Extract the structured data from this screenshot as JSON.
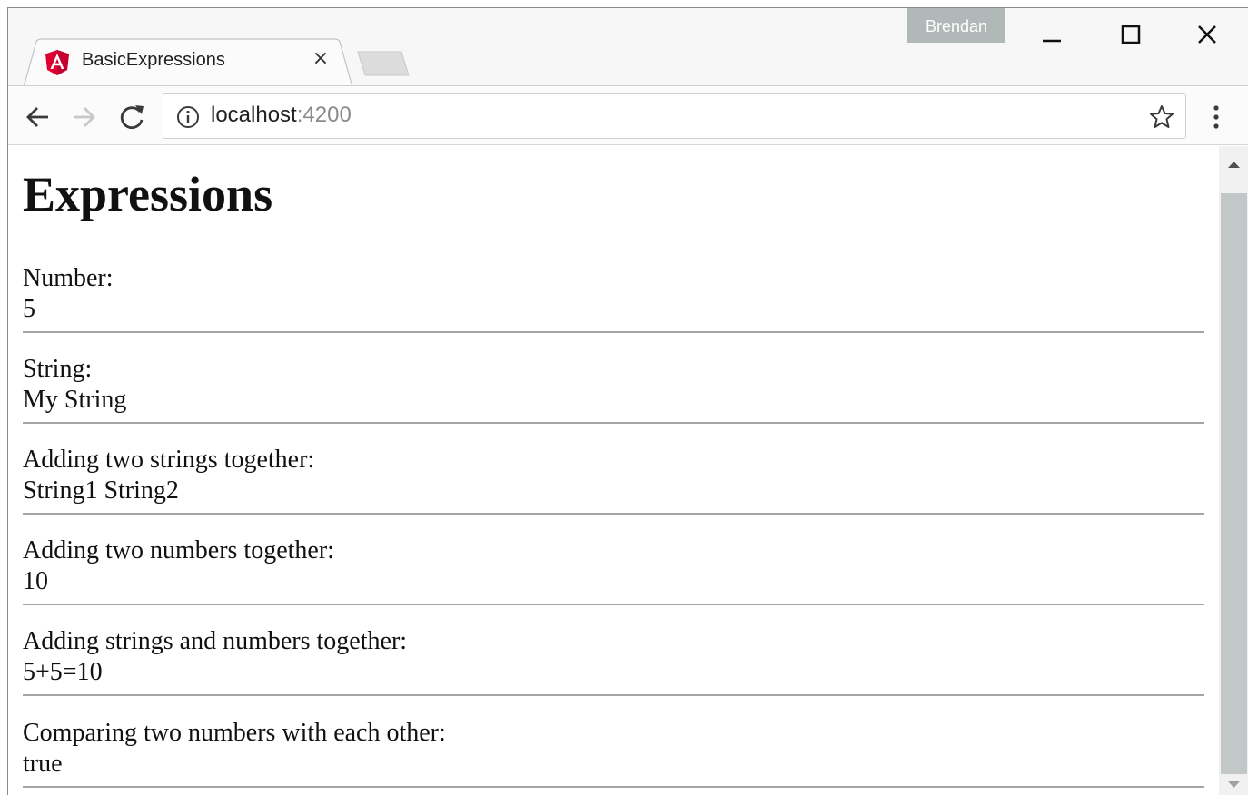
{
  "browser": {
    "tab": {
      "title": "BasicExpressions",
      "close_glyph": "×",
      "favicon": "angular-logo-icon"
    },
    "profile_name": "Brendan",
    "address": {
      "host": "localhost",
      "port": ":4200"
    },
    "icons": {
      "back": "back-arrow-icon",
      "forward": "forward-arrow-icon",
      "reload": "reload-icon",
      "info": "info-icon",
      "bookmark": "star-icon",
      "menu": "kebab-menu-icon",
      "minimize": "minimize-icon",
      "maximize": "maximize-icon",
      "close": "close-icon"
    }
  },
  "page": {
    "title": "Expressions",
    "sections": [
      {
        "label": "Number:",
        "value": "5"
      },
      {
        "label": "String:",
        "value": "My String"
      },
      {
        "label": "Adding two strings together:",
        "value": "String1 String2"
      },
      {
        "label": "Adding two numbers together:",
        "value": "10"
      },
      {
        "label": "Adding strings and numbers together:",
        "value": "5+5=10"
      },
      {
        "label": "Comparing two numbers with each other:",
        "value": "true"
      }
    ]
  },
  "colors": {
    "angular_red": "#dd0031",
    "profile_badge": "#b0b8b8",
    "rule": "#a5a5a5",
    "scroll_thumb": "#c2c8c8"
  }
}
